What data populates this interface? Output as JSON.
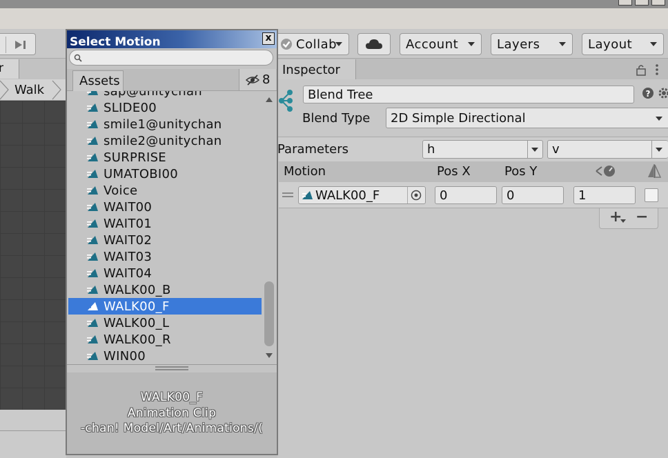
{
  "toolbar": {
    "collab_label": "Collab",
    "account_label": "Account",
    "layers_label": "Layers",
    "layout_label": "Layout"
  },
  "scene": {
    "tab_label": "r",
    "breadcrumb_label": "Walk"
  },
  "inspector": {
    "tab_label": "Inspector",
    "name_value": "Blend Tree",
    "blend_type_label": "Blend Type",
    "blend_type_value": "2D Simple Directional",
    "parameters_label": "Parameters",
    "param_x": "h",
    "param_y": "v",
    "columns": {
      "motion": "Motion",
      "pos_x": "Pos X",
      "pos_y": "Pos Y"
    },
    "row": {
      "motion": "WALK00_F",
      "pos_x": "0",
      "pos_y": "0",
      "speed": "1"
    },
    "add_label": "+",
    "remove_label": "−"
  },
  "dialog": {
    "title": "Select Motion",
    "close_label": "x",
    "search_placeholder": "",
    "tab_assets": "Assets",
    "hidden_count": "8",
    "items": [
      {
        "label": "sap@unitychan",
        "selected": false
      },
      {
        "label": "SLIDE00",
        "selected": false
      },
      {
        "label": "smile1@unitychan",
        "selected": false
      },
      {
        "label": "smile2@unitychan",
        "selected": false
      },
      {
        "label": "SURPRISE",
        "selected": false
      },
      {
        "label": "UMATOBI00",
        "selected": false
      },
      {
        "label": "Voice",
        "selected": false
      },
      {
        "label": "WAIT00",
        "selected": false
      },
      {
        "label": "WAIT01",
        "selected": false
      },
      {
        "label": "WAIT02",
        "selected": false
      },
      {
        "label": "WAIT03",
        "selected": false
      },
      {
        "label": "WAIT04",
        "selected": false
      },
      {
        "label": "WALK00_B",
        "selected": false
      },
      {
        "label": "WALK00_F",
        "selected": true
      },
      {
        "label": "WALK00_L",
        "selected": false
      },
      {
        "label": "WALK00_R",
        "selected": false
      },
      {
        "label": "WIN00",
        "selected": false
      }
    ],
    "preview": {
      "name": "WALK00_F",
      "type": "Animation Clip",
      "path": "-chan! Model/Art/Animations/("
    }
  },
  "colors": {
    "selection": "#3b7ad9",
    "clip_icon": "#1f6f86",
    "title_bar_start": "#0e2a6e",
    "title_bar_end": "#a8c0e2"
  }
}
